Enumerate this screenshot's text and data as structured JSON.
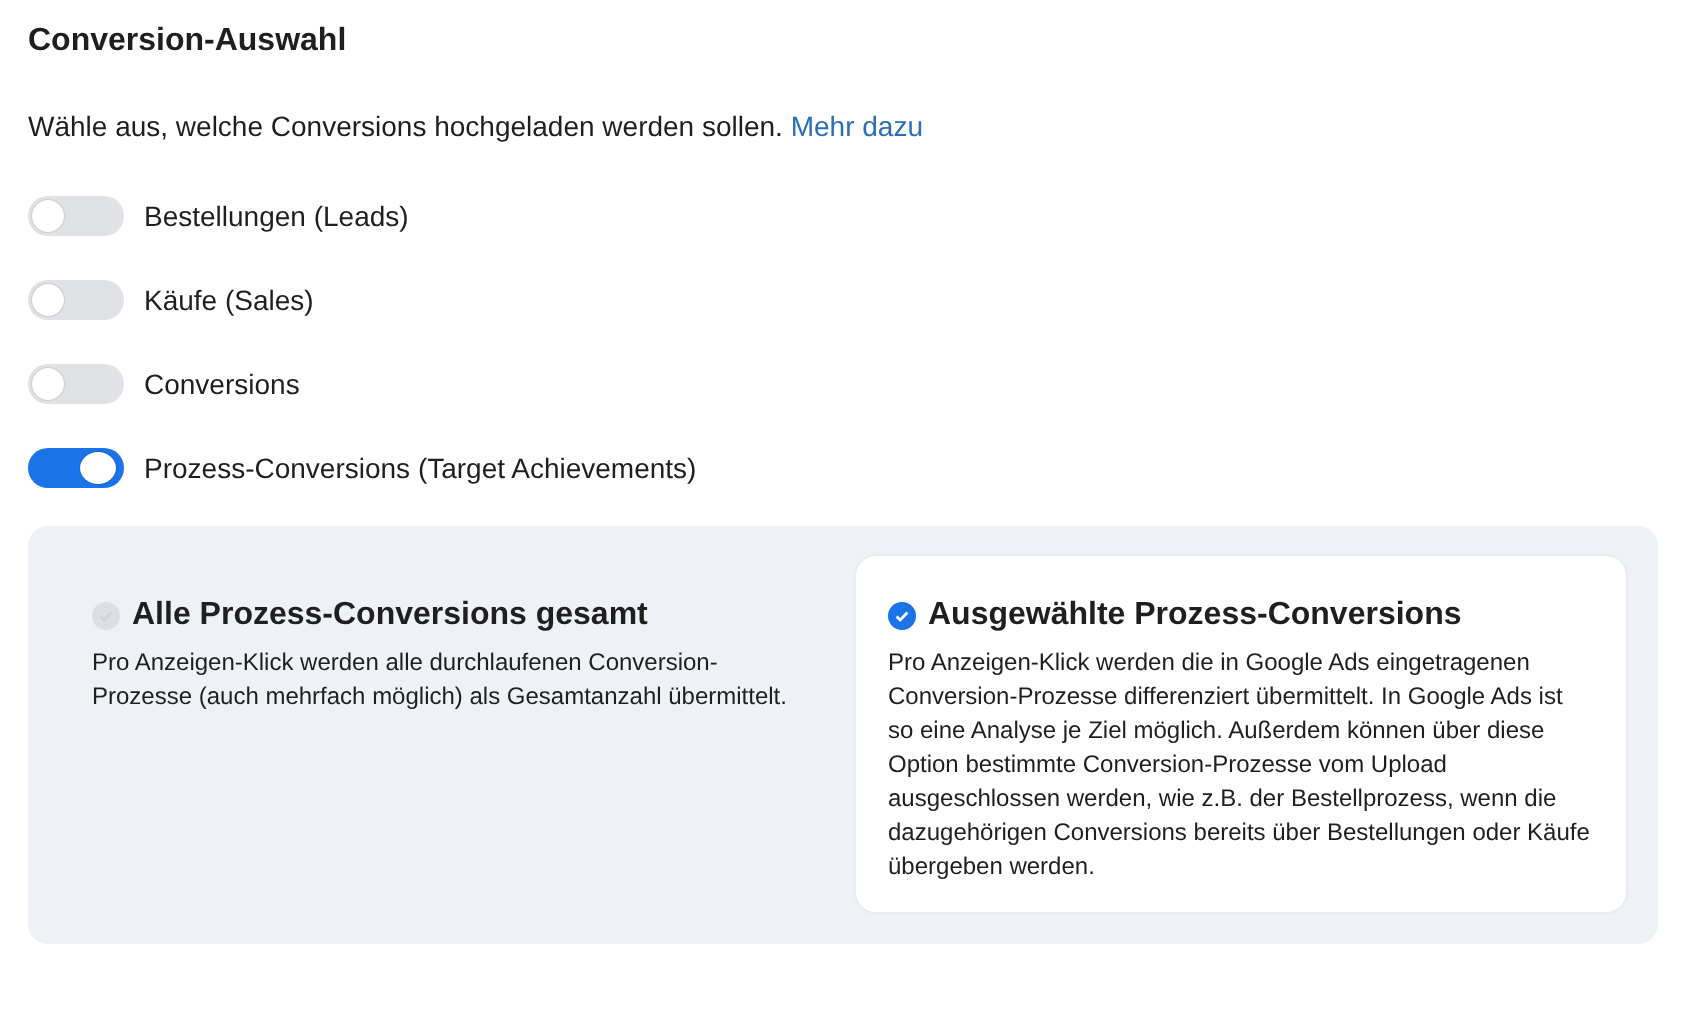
{
  "title": "Conversion-Auswahl",
  "intro": {
    "text": "Wähle aus, welche Conversions hochgeladen werden sollen.",
    "link": "Mehr dazu"
  },
  "toggles": [
    {
      "label": "Bestellungen (Leads)",
      "on": false
    },
    {
      "label": "Käufe (Sales)",
      "on": false
    },
    {
      "label": "Conversions",
      "on": false
    },
    {
      "label": "Prozess-Conversions (Target Achievements)",
      "on": true
    }
  ],
  "options": [
    {
      "title": "Alle Prozess-Conversions gesamt",
      "description": "Pro Anzeigen-Klick werden alle durchlaufenen Conversion-Prozesse (auch mehrfach möglich) als Gesamtanzahl übermittelt.",
      "selected": false
    },
    {
      "title": "Ausgewählte Prozess-Conversions",
      "description": "Pro Anzeigen-Klick werden die in Google Ads eingetragenen Conversion-Prozesse differenziert übermittelt. In Google Ads ist so eine Analyse je Ziel möglich. Außerdem können über diese Option bestimmte Conversion-Prozesse vom Upload ausgeschlossen werden, wie z.B. der Bestellprozess, wenn die dazugehörigen Conversions bereits über Bestellungen oder Käufe übergeben werden.",
      "selected": true
    }
  ]
}
